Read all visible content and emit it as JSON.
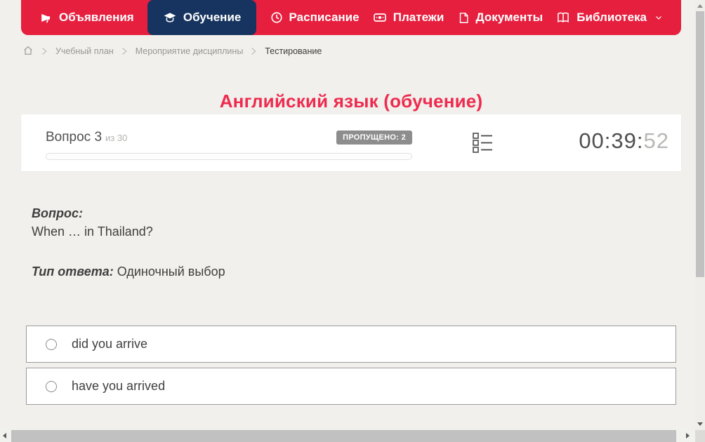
{
  "nav": {
    "items": [
      {
        "label": "Объявления",
        "icon": "megaphone-icon",
        "active": false
      },
      {
        "label": "Обучение",
        "icon": "graduation-cap-icon",
        "active": true
      },
      {
        "label": "Расписание",
        "icon": "clock-icon",
        "active": false
      },
      {
        "label": "Платежи",
        "icon": "banknote-icon",
        "active": false
      },
      {
        "label": "Документы",
        "icon": "document-icon",
        "active": false
      },
      {
        "label": "Библиотека",
        "icon": "book-icon",
        "active": false,
        "has_dropdown": true
      }
    ],
    "colors": {
      "bar": "#e61f3e",
      "active_tab": "#16345f",
      "text": "#ffffff"
    }
  },
  "breadcrumb": {
    "home_icon": "home-icon",
    "items": [
      {
        "label": "Учебный план",
        "current": false
      },
      {
        "label": "Мероприятие дисциплины",
        "current": false
      },
      {
        "label": "Тестирование",
        "current": true
      }
    ]
  },
  "page": {
    "title": "Английский язык (обучение)",
    "title_color": "#ee2b4e",
    "background_color": "#f1f0ec"
  },
  "question_panel": {
    "question_label": "Вопрос 3",
    "question_of": "из 30",
    "skipped_badge": "ПРОПУЩЕНО: 2",
    "skipped_badge_color": "#8d8d8d",
    "progress_percent": 0,
    "question_list_icon": "question-list-icon",
    "timer": {
      "main": "00:39:",
      "seconds": "52"
    }
  },
  "question": {
    "label": "Вопрос:",
    "text": "When … in Thailand?",
    "answer_type_label": "Тип ответа:",
    "answer_type": "Одиночный выбор",
    "options": [
      {
        "label": "did you arrive",
        "selected": false
      },
      {
        "label": "have you arrived",
        "selected": false
      }
    ]
  }
}
